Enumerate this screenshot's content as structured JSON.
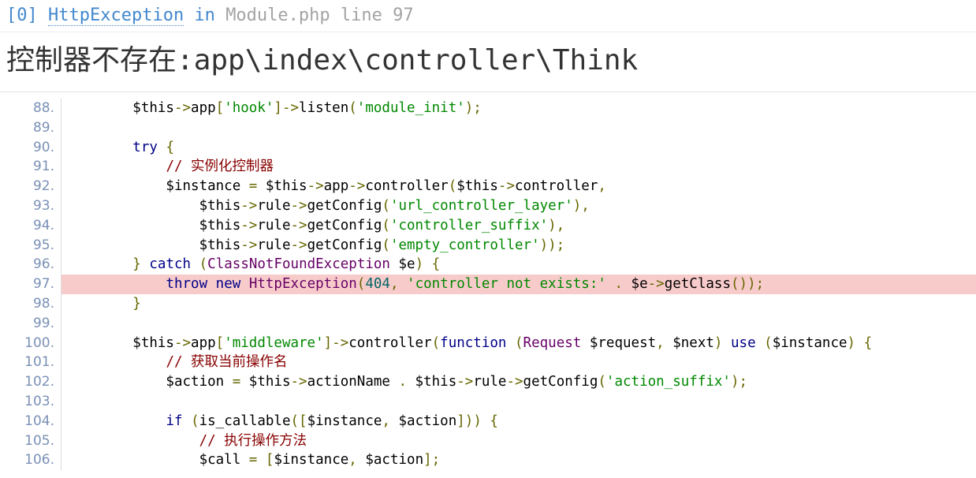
{
  "exception_header": {
    "index": "[0]",
    "class": "HttpException",
    "in_word": "in",
    "file": "Module.php",
    "line_word": "line",
    "line": "97"
  },
  "message": {
    "label": "控制器不存在",
    "path": ":app\\index\\controller\\Think"
  },
  "colors": {
    "link": "#4288ce",
    "highlight": "#f8cbcb",
    "keyword": "#000088",
    "string": "#008800",
    "comment": "#880000",
    "type": "#660066",
    "punctuation": "#666600",
    "literal": "#006666"
  },
  "source": {
    "highlight_line": "97.",
    "lines": [
      {
        "n": "88.",
        "tokens": [
          [
            "pln",
            "        $this"
          ],
          [
            "pun",
            "->"
          ],
          [
            "pln",
            "app"
          ],
          [
            "pun",
            "["
          ],
          [
            "str",
            "'hook'"
          ],
          [
            "pun",
            "]->"
          ],
          [
            "pln",
            "listen"
          ],
          [
            "pun",
            "("
          ],
          [
            "str",
            "'module_init'"
          ],
          [
            "pun",
            ");"
          ]
        ]
      },
      {
        "n": "89.",
        "tokens": []
      },
      {
        "n": "90.",
        "tokens": [
          [
            "pln",
            "        "
          ],
          [
            "kwd",
            "try"
          ],
          [
            "pln",
            " "
          ],
          [
            "pun",
            "{"
          ]
        ]
      },
      {
        "n": "91.",
        "tokens": [
          [
            "pln",
            "            "
          ],
          [
            "com",
            "// "
          ],
          [
            "com-cjk",
            "实例化控制器"
          ]
        ]
      },
      {
        "n": "92.",
        "tokens": [
          [
            "pln",
            "            $instance "
          ],
          [
            "pun",
            "="
          ],
          [
            "pln",
            " $this"
          ],
          [
            "pun",
            "->"
          ],
          [
            "pln",
            "app"
          ],
          [
            "pun",
            "->"
          ],
          [
            "pln",
            "controller"
          ],
          [
            "pun",
            "("
          ],
          [
            "pln",
            "$this"
          ],
          [
            "pun",
            "->"
          ],
          [
            "pln",
            "controller"
          ],
          [
            "pun",
            ","
          ]
        ]
      },
      {
        "n": "93.",
        "tokens": [
          [
            "pln",
            "                $this"
          ],
          [
            "pun",
            "->"
          ],
          [
            "pln",
            "rule"
          ],
          [
            "pun",
            "->"
          ],
          [
            "pln",
            "getConfig"
          ],
          [
            "pun",
            "("
          ],
          [
            "str",
            "'url_controller_layer'"
          ],
          [
            "pun",
            "),"
          ]
        ]
      },
      {
        "n": "94.",
        "tokens": [
          [
            "pln",
            "                $this"
          ],
          [
            "pun",
            "->"
          ],
          [
            "pln",
            "rule"
          ],
          [
            "pun",
            "->"
          ],
          [
            "pln",
            "getConfig"
          ],
          [
            "pun",
            "("
          ],
          [
            "str",
            "'controller_suffix'"
          ],
          [
            "pun",
            "),"
          ]
        ]
      },
      {
        "n": "95.",
        "tokens": [
          [
            "pln",
            "                $this"
          ],
          [
            "pun",
            "->"
          ],
          [
            "pln",
            "rule"
          ],
          [
            "pun",
            "->"
          ],
          [
            "pln",
            "getConfig"
          ],
          [
            "pun",
            "("
          ],
          [
            "str",
            "'empty_controller'"
          ],
          [
            "pun",
            "));"
          ]
        ]
      },
      {
        "n": "96.",
        "tokens": [
          [
            "pln",
            "        "
          ],
          [
            "pun",
            "}"
          ],
          [
            "pln",
            " "
          ],
          [
            "kwd",
            "catch"
          ],
          [
            "pln",
            " "
          ],
          [
            "pun",
            "("
          ],
          [
            "typ",
            "ClassNotFoundException"
          ],
          [
            "pln",
            " $e"
          ],
          [
            "pun",
            ")"
          ],
          [
            "pln",
            " "
          ],
          [
            "pun",
            "{"
          ]
        ]
      },
      {
        "n": "97.",
        "tokens": [
          [
            "pln",
            "            "
          ],
          [
            "kwd",
            "throw"
          ],
          [
            "pln",
            " "
          ],
          [
            "kwd",
            "new"
          ],
          [
            "pln",
            " "
          ],
          [
            "typ",
            "HttpException"
          ],
          [
            "pun",
            "("
          ],
          [
            "lit",
            "404"
          ],
          [
            "pun",
            ","
          ],
          [
            "pln",
            " "
          ],
          [
            "str",
            "'controller not exists:'"
          ],
          [
            "pln",
            " "
          ],
          [
            "pun",
            "."
          ],
          [
            "pln",
            " $e"
          ],
          [
            "pun",
            "->"
          ],
          [
            "pln",
            "getClass"
          ],
          [
            "pun",
            "());"
          ]
        ]
      },
      {
        "n": "98.",
        "tokens": [
          [
            "pln",
            "        "
          ],
          [
            "pun",
            "}"
          ]
        ]
      },
      {
        "n": "99.",
        "tokens": []
      },
      {
        "n": "100.",
        "tokens": [
          [
            "pln",
            "        $this"
          ],
          [
            "pun",
            "->"
          ],
          [
            "pln",
            "app"
          ],
          [
            "pun",
            "["
          ],
          [
            "str",
            "'middleware'"
          ],
          [
            "pun",
            "]->"
          ],
          [
            "pln",
            "controller"
          ],
          [
            "pun",
            "("
          ],
          [
            "kwd",
            "function"
          ],
          [
            "pln",
            " "
          ],
          [
            "pun",
            "("
          ],
          [
            "typ",
            "Request"
          ],
          [
            "pln",
            " $request"
          ],
          [
            "pun",
            ","
          ],
          [
            "pln",
            " $next"
          ],
          [
            "pun",
            ")"
          ],
          [
            "pln",
            " "
          ],
          [
            "kwd",
            "use"
          ],
          [
            "pln",
            " "
          ],
          [
            "pun",
            "("
          ],
          [
            "pln",
            "$instance"
          ],
          [
            "pun",
            ")"
          ],
          [
            "pln",
            " "
          ],
          [
            "pun",
            "{"
          ]
        ]
      },
      {
        "n": "101.",
        "tokens": [
          [
            "pln",
            "            "
          ],
          [
            "com",
            "// "
          ],
          [
            "com-cjk",
            "获取当前操作名"
          ]
        ]
      },
      {
        "n": "102.",
        "tokens": [
          [
            "pln",
            "            $action "
          ],
          [
            "pun",
            "="
          ],
          [
            "pln",
            " $this"
          ],
          [
            "pun",
            "->"
          ],
          [
            "pln",
            "actionName "
          ],
          [
            "pun",
            "."
          ],
          [
            "pln",
            " $this"
          ],
          [
            "pun",
            "->"
          ],
          [
            "pln",
            "rule"
          ],
          [
            "pun",
            "->"
          ],
          [
            "pln",
            "getConfig"
          ],
          [
            "pun",
            "("
          ],
          [
            "str",
            "'action_suffix'"
          ],
          [
            "pun",
            ");"
          ]
        ]
      },
      {
        "n": "103.",
        "tokens": []
      },
      {
        "n": "104.",
        "tokens": [
          [
            "pln",
            "            "
          ],
          [
            "kwd",
            "if"
          ],
          [
            "pln",
            " "
          ],
          [
            "pun",
            "("
          ],
          [
            "pln",
            "is_callable"
          ],
          [
            "pun",
            "(["
          ],
          [
            "pln",
            "$instance"
          ],
          [
            "pun",
            ","
          ],
          [
            "pln",
            " $action"
          ],
          [
            "pun",
            "]))"
          ],
          [
            "pln",
            " "
          ],
          [
            "pun",
            "{"
          ]
        ]
      },
      {
        "n": "105.",
        "tokens": [
          [
            "pln",
            "                "
          ],
          [
            "com",
            "// "
          ],
          [
            "com-cjk",
            "执行操作方法"
          ]
        ]
      },
      {
        "n": "106.",
        "tokens": [
          [
            "pln",
            "                $call "
          ],
          [
            "pun",
            "="
          ],
          [
            "pln",
            " "
          ],
          [
            "pun",
            "["
          ],
          [
            "pln",
            "$instance"
          ],
          [
            "pun",
            ","
          ],
          [
            "pln",
            " $action"
          ],
          [
            "pun",
            "];"
          ]
        ]
      }
    ]
  }
}
